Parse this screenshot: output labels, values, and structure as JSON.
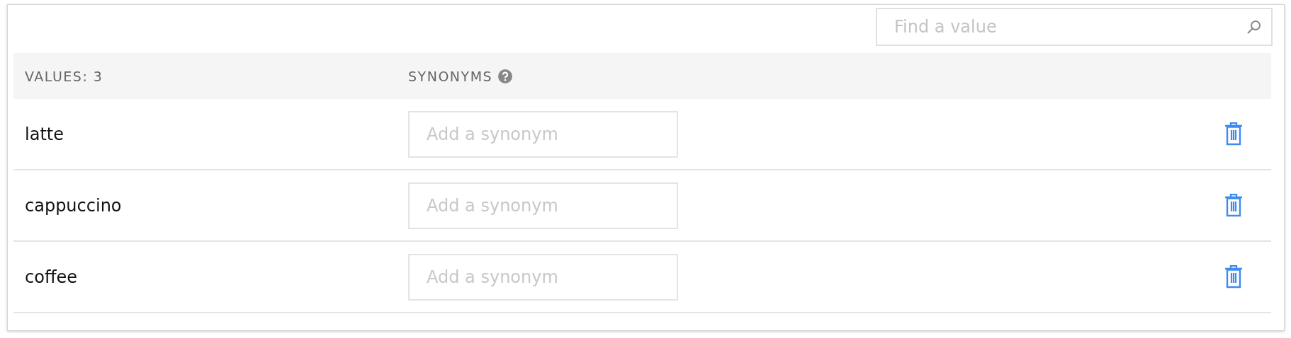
{
  "search": {
    "placeholder": "Find a value"
  },
  "table": {
    "columns": [
      "VALUES: 3",
      "SYNONYMS"
    ],
    "rows": [
      {
        "value": "latte",
        "synonym_placeholder": "Add a synonym"
      },
      {
        "value": "cappuccino",
        "synonym_placeholder": "Add a synonym"
      },
      {
        "value": "coffee",
        "synonym_placeholder": "Add a synonym"
      }
    ]
  }
}
